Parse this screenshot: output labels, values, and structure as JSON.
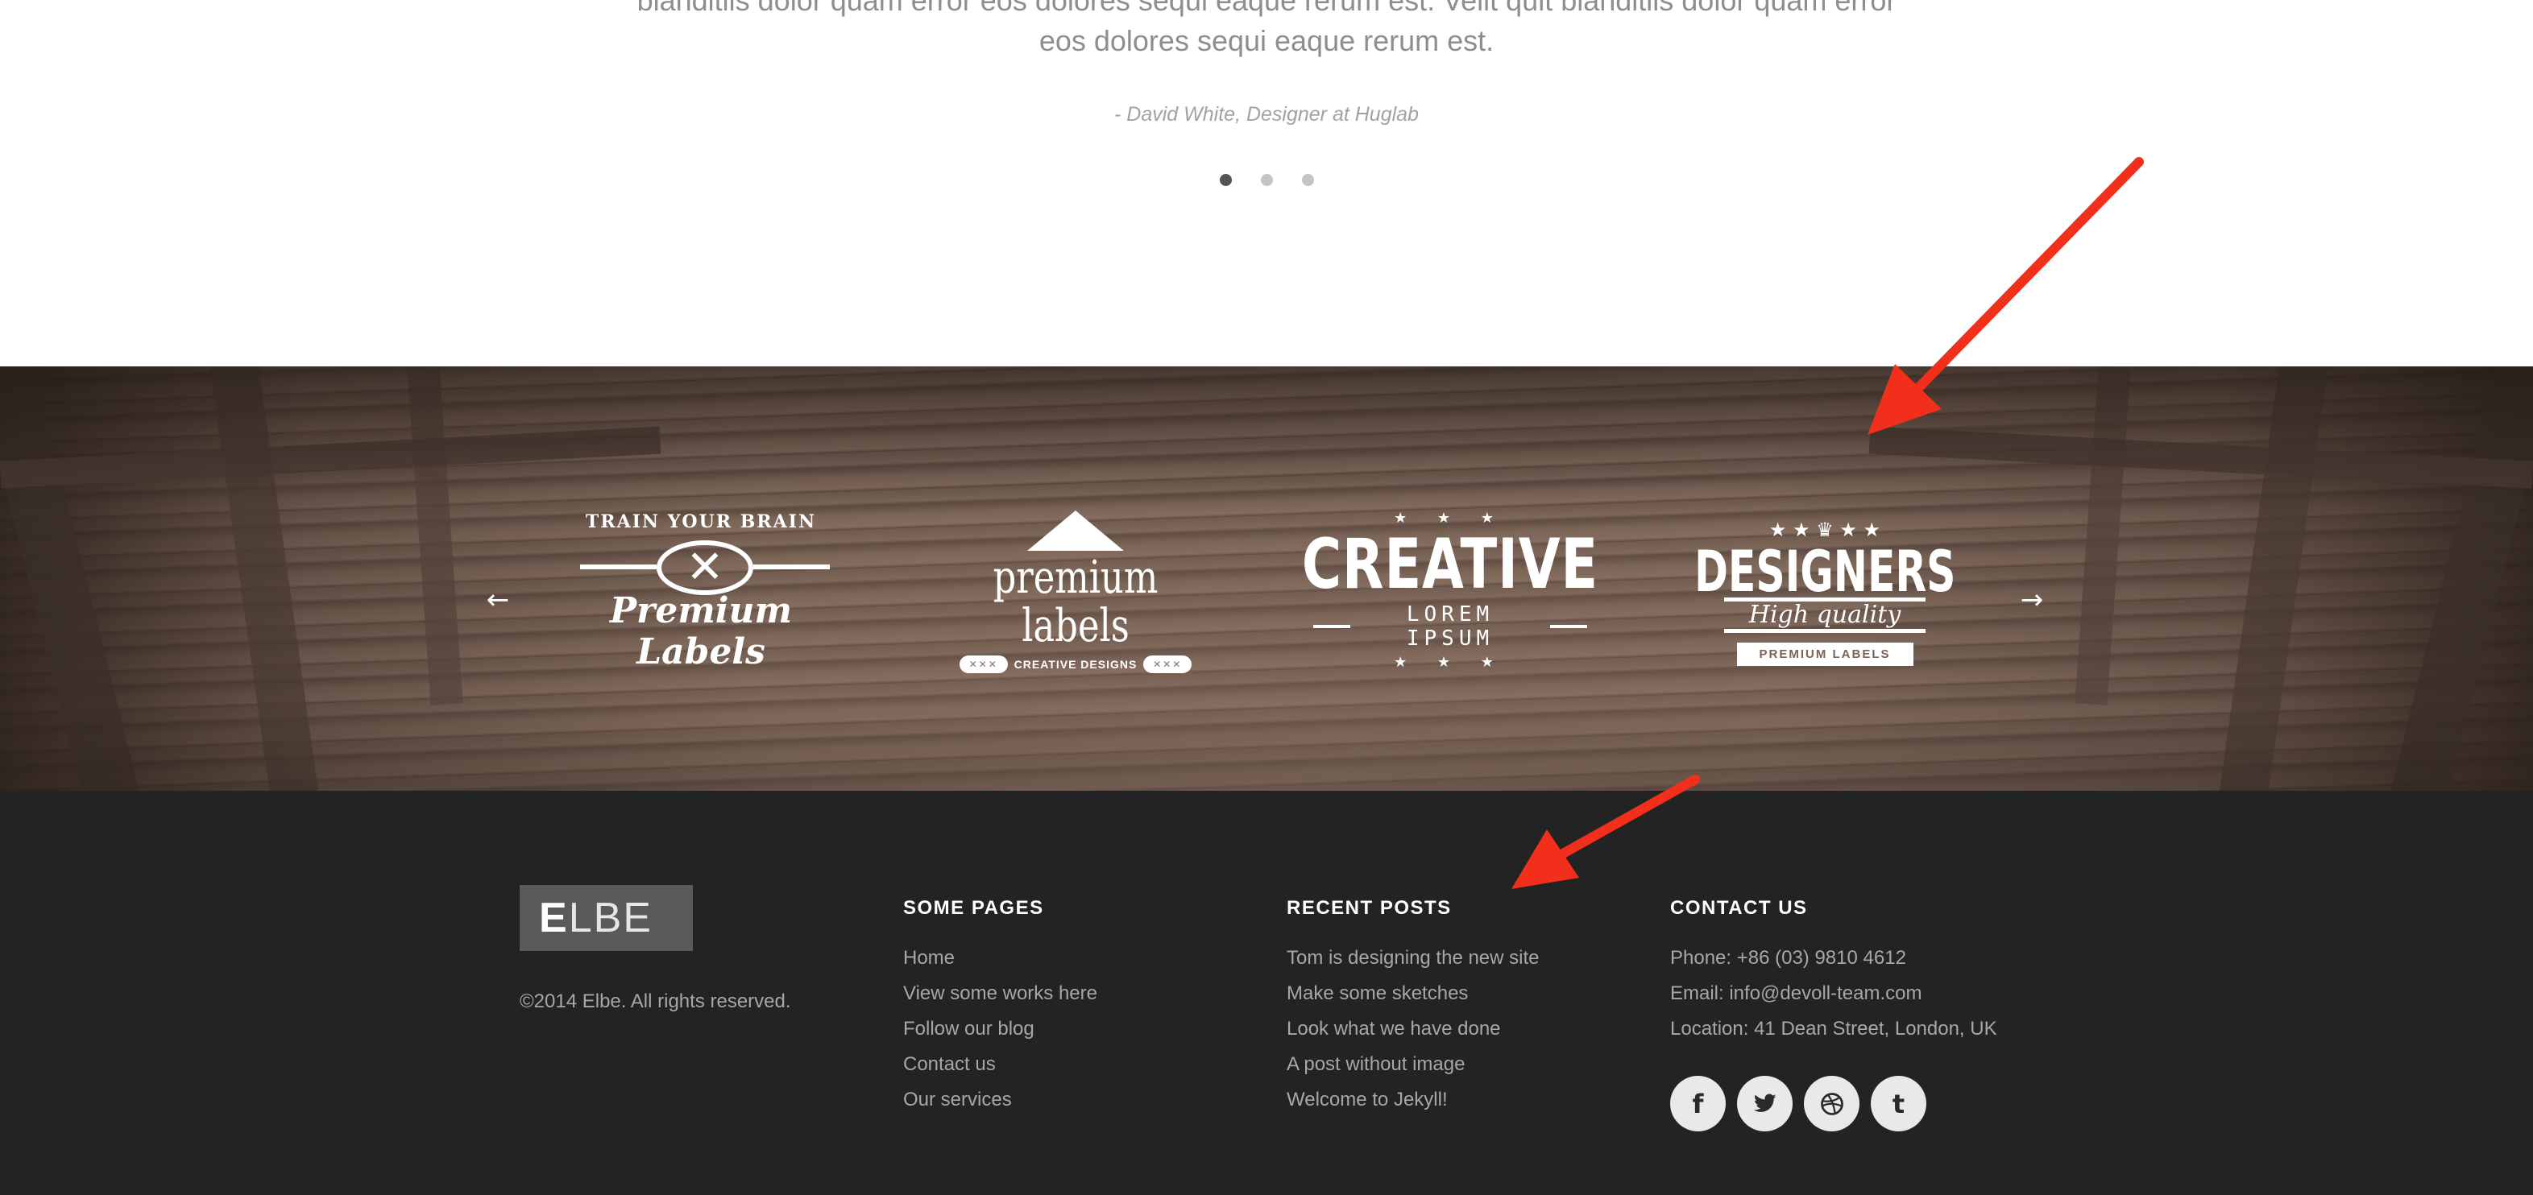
{
  "testimonial": {
    "quote_line1": "blanditiis dolor quam error eos dolores sequi eaque rerum est. Velit quit blanditiis dolor quam error",
    "quote_line2": "eos dolores sequi eaque rerum est.",
    "author": "- David White, Designer at Huglab",
    "dots": 3,
    "active_dot": 0
  },
  "clients": {
    "prev_arrow": "←",
    "next_arrow": "→",
    "logos": [
      {
        "top": "TRAIN YOUR BRAIN",
        "emblem": "✕",
        "bottom": "Premium Labels"
      },
      {
        "main": "premium labels",
        "pill": "✕✕✕",
        "sub": "CREATIVE DESIGNS"
      },
      {
        "stars": "★ ★ ★",
        "main": "CREATIVE",
        "sub": "LOREM IPSUM",
        "bottom_stars": "★ ★ ★"
      },
      {
        "crown": "♛",
        "stars": "★ ★",
        "main": "DESIGNERS",
        "script": "High quality",
        "ribbon": "PREMIUM LABELS"
      }
    ]
  },
  "footer": {
    "brand_first": "E",
    "brand_rest": "LBE",
    "copyright": "©2014 Elbe. All rights reserved.",
    "pages": {
      "heading": "SOME PAGES",
      "items": [
        "Home",
        "View some works here",
        "Follow our blog",
        "Contact us",
        "Our services"
      ]
    },
    "posts": {
      "heading": "RECENT POSTS",
      "items": [
        "Tom is designing the new site",
        "Make some sketches",
        "Look what we have done",
        "A post without image",
        "Welcome to Jekyll!"
      ]
    },
    "contact": {
      "heading": "CONTACT US",
      "phone": "Phone: +86 (03) 9810 4612",
      "email": "Email: info@devoll-team.com",
      "location": "Location: 41 Dean Street, London, UK"
    },
    "social": [
      {
        "icon": "facebook-icon",
        "glyph": "f"
      },
      {
        "icon": "twitter-icon",
        "glyph": "🐦"
      },
      {
        "icon": "dribbble-icon",
        "glyph": "⊛"
      },
      {
        "icon": "tumblr-icon",
        "glyph": "t"
      }
    ]
  },
  "colors": {
    "footer_bg": "#232323",
    "brand_bg": "#5a5a5a",
    "link_text": "#a7a7a7",
    "annotation_arrow": "#f22f1b"
  }
}
